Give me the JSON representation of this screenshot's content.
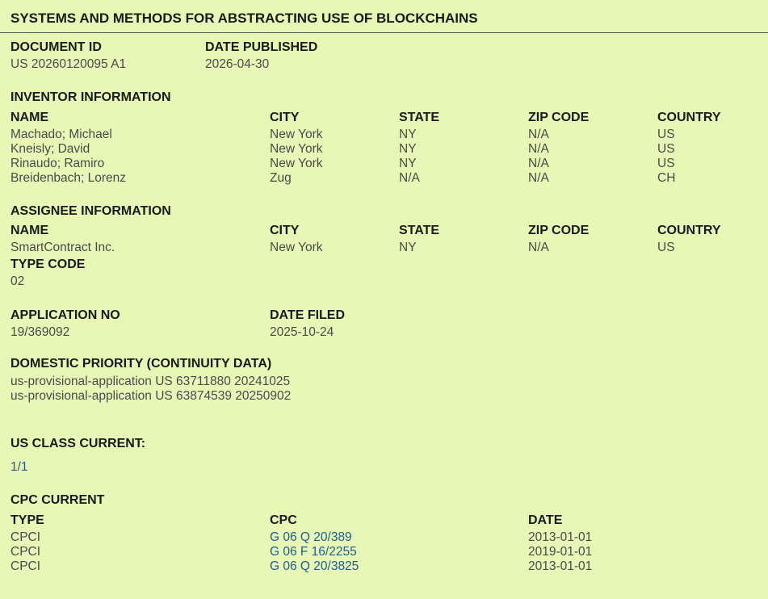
{
  "title": "SYSTEMS AND METHODS FOR ABSTRACTING USE OF BLOCKCHAINS",
  "document": {
    "id_label": "DOCUMENT ID",
    "id_value": "US 20260120095 A1",
    "published_label": "DATE PUBLISHED",
    "published_value": "2026-04-30"
  },
  "inventors": {
    "section_label": "INVENTOR INFORMATION",
    "headers": [
      "NAME",
      "CITY",
      "STATE",
      "ZIP CODE",
      "COUNTRY"
    ],
    "rows": [
      [
        "Machado; Michael",
        "New York",
        "NY",
        "N/A",
        "US"
      ],
      [
        "Kneisly; David",
        "New York",
        "NY",
        "N/A",
        "US"
      ],
      [
        "Rinaudo; Ramiro",
        "New York",
        "NY",
        "N/A",
        "US"
      ],
      [
        "Breidenbach; Lorenz",
        "Zug",
        "N/A",
        "N/A",
        "CH"
      ]
    ]
  },
  "assignee": {
    "section_label": "ASSIGNEE INFORMATION",
    "headers": [
      "NAME",
      "CITY",
      "STATE",
      "ZIP CODE",
      "COUNTRY"
    ],
    "row": [
      "SmartContract Inc.",
      "New York",
      "NY",
      "N/A",
      "US"
    ],
    "type_code_label": "TYPE CODE",
    "type_code_value": "02"
  },
  "application": {
    "no_label": "APPLICATION NO",
    "no_value": "19/369092",
    "filed_label": "DATE FILED",
    "filed_value": "2025-10-24"
  },
  "domestic_priority": {
    "label": "DOMESTIC PRIORITY (CONTINUITY DATA)",
    "lines": [
      "us-provisional-application US 63711880 20241025",
      "us-provisional-application US 63874539 20250902"
    ]
  },
  "us_class": {
    "label": "US CLASS CURRENT:",
    "value": "1/1"
  },
  "cpc": {
    "label": "CPC CURRENT",
    "headers": [
      "TYPE",
      "CPC",
      "DATE"
    ],
    "rows": [
      [
        "CPCI",
        "G 06 Q 20/389",
        "2013-01-01"
      ],
      [
        "CPCI",
        "G 06 F 16/2255",
        "2019-01-01"
      ],
      [
        "CPCI",
        "G 06 Q 20/3825",
        "2013-01-01"
      ]
    ]
  },
  "colors": {
    "background": "#e6f7b6",
    "link": "#1f5e8c"
  }
}
